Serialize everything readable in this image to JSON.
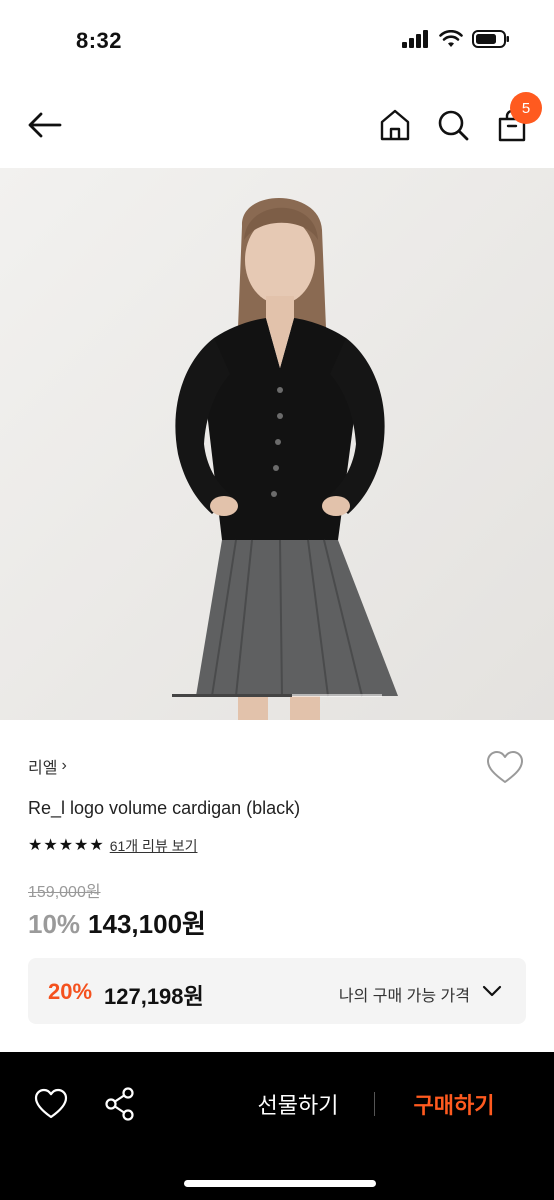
{
  "status_bar": {
    "time": "8:32"
  },
  "nav": {
    "back_icon": "arrow-left-icon",
    "home_icon": "home-icon",
    "search_icon": "search-icon",
    "bag_icon": "shopping-bag-icon",
    "cart_count": "5"
  },
  "hero": {
    "alt": "product-photo",
    "slide_progress": 0.57
  },
  "product": {
    "brand": "리엘",
    "brand_chevron": "›",
    "name": "Re_l logo volume cardigan (black)",
    "rating_stars": 5,
    "reviews_label": "61개 리뷰 보기",
    "original_price": "159,000원",
    "discount": "10%",
    "sale_price": "143,100원"
  },
  "my_price": {
    "discount": "20%",
    "price": "127,198원",
    "label": "나의 구매 가능 가격"
  },
  "bottom_bar": {
    "gift_label": "선물하기",
    "buy_label": "구매하기"
  },
  "colors": {
    "accent": "#ff5a1f",
    "my_discount": "#f4511e",
    "bottom_bar_bg": "#000000"
  }
}
